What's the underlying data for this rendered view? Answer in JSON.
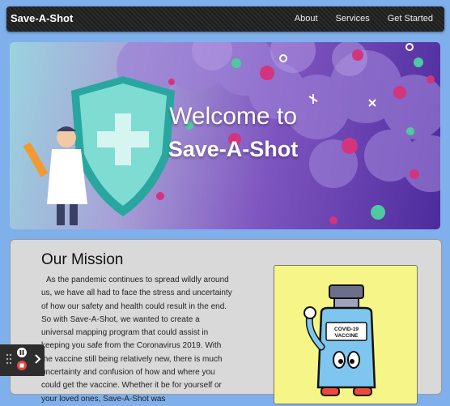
{
  "navbar": {
    "brand": "Save-A-Shot",
    "links": [
      "About",
      "Services",
      "Get Started"
    ]
  },
  "hero": {
    "line1": "Welcome to",
    "line2": "Save-A-Shot"
  },
  "mission": {
    "title": "Our Mission",
    "text": "As the pandemic continues to spread wildly around us, we have all had to face the stress and uncertainty of how our safety and health could result in the end. So with Save-A-Shot, we wanted to create a universal mapping program that could assist in keeping you safe from the Coronavirus 2019. With the vaccine still being relatively new, there is much uncertainty and confusion of how and where you could get the vaccine. Whether it be for yourself or your loved ones, Save-A-Shot was",
    "image_label": "COVID-19 VACCINE"
  },
  "colors": {
    "page_bg": "#7fb0ec",
    "navbar_bg": "#242424",
    "card_bg": "#d9d9d9",
    "vaccine_bg": "#f6f587"
  },
  "icons": [
    "drag-handle-icon",
    "pause-icon",
    "record-stop-icon",
    "chevron-right-icon"
  ]
}
